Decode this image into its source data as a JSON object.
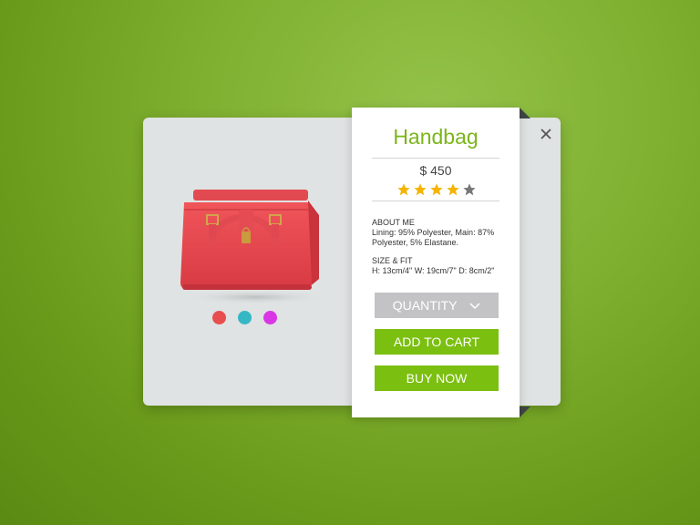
{
  "product": {
    "title": "Handbag",
    "price": "$ 450",
    "rating": {
      "value": 4,
      "max": 5
    },
    "about_heading": "ABOUT ME",
    "about_text": "Lining: 95% Polyester, Main: 87% Polyester, 5% Elastane.",
    "size_heading": "SIZE & FIT",
    "size_text": "H: 13cm/4\" W: 19cm/7\" D: 8cm/2\""
  },
  "buttons": {
    "quantity": "QUANTITY",
    "add_to_cart": "ADD TO CART",
    "buy_now": "BUY NOW"
  },
  "color_options": [
    "#e84e4e",
    "#35b7c4",
    "#d936e6"
  ],
  "colors": {
    "accent": "#7bbf10",
    "star_filled": "#f4b400",
    "star_empty": "#777777",
    "quantity_button": "#c3c3c5"
  },
  "icons": {
    "close": "close-icon",
    "dropdown": "chevron-down-icon",
    "star": "star-icon"
  }
}
